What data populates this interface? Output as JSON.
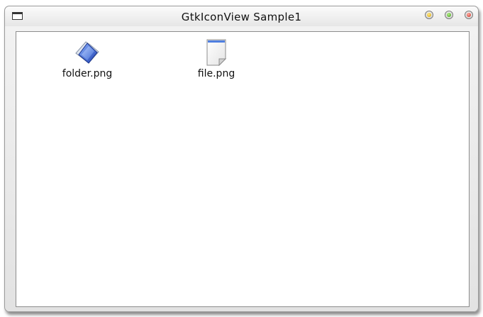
{
  "window": {
    "title": "GtkIconView Sample1"
  },
  "titlebar": {
    "menu_icon": "window-menu-icon",
    "buttons": [
      "minimize",
      "maximize",
      "close"
    ]
  },
  "icon_view": {
    "items": [
      {
        "label": "folder.png",
        "icon": "folder-icon"
      },
      {
        "label": "file.png",
        "icon": "file-icon"
      }
    ]
  },
  "colors": {
    "folder_blue": "#2f5fd0",
    "minimize": "#e0b000",
    "maximize": "#3c9a14",
    "close": "#c8281a"
  }
}
